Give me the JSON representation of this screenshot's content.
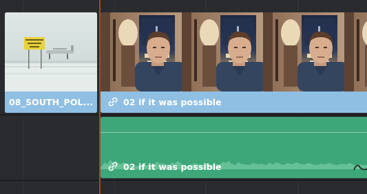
{
  "timeline": {
    "video_track": {
      "clips": [
        {
          "label": "08_SOUTH_POL...",
          "selected": true,
          "linked": false
        },
        {
          "label": "02 if it was possible",
          "selected": false,
          "linked": true
        }
      ]
    },
    "audio_track": {
      "clips": [
        {
          "label": "02 if it was possible",
          "linked": true
        }
      ]
    },
    "colors": {
      "video_clip": "#8fbfe3",
      "audio_clip": "#3ea77a",
      "playhead": "#c0392b",
      "background": "#2a2b2f"
    }
  }
}
